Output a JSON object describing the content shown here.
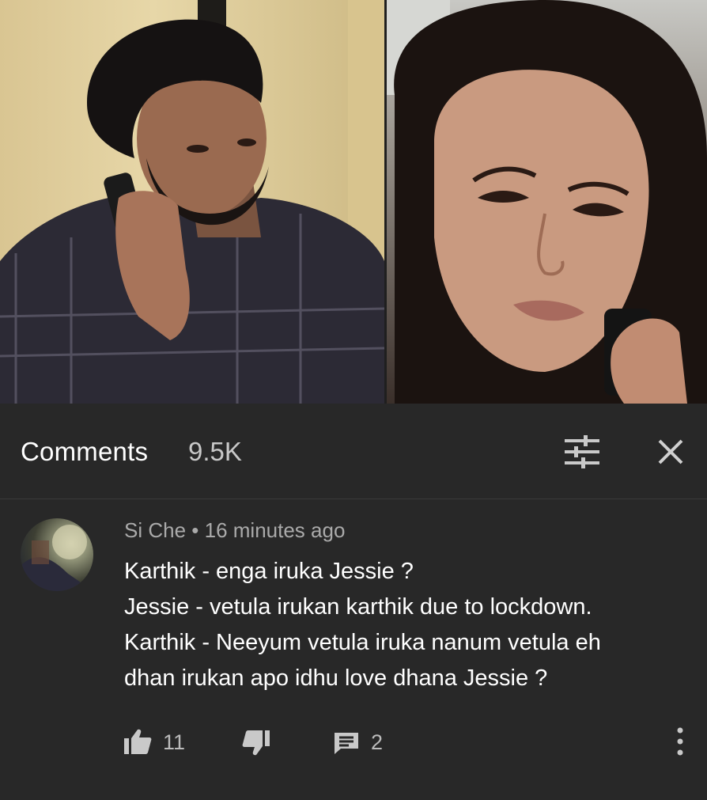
{
  "comments_panel": {
    "title": "Comments",
    "count": "9.5K",
    "sort_icon": "sort-sliders-icon",
    "close_icon": "close-icon"
  },
  "comment": {
    "author": "Si Che",
    "separator": "•",
    "time": "16 minutes ago",
    "lines": [
      "Karthik - enga iruka Jessie ?",
      "Jessie - vetula irukan karthik due to lockdown.",
      "Karthik - Neeyum vetula iruka nanum vetula eh",
      "dhan irukan apo idhu love dhana Jessie ?"
    ],
    "likes": "11",
    "replies": "2",
    "icons": {
      "like": "thumbs-up-icon",
      "dislike": "thumbs-down-icon",
      "reply": "reply-comment-icon",
      "more": "more-vertical-icon"
    }
  },
  "colors": {
    "background": "#282828",
    "text": "#ffffff",
    "secondary_text": "#aaaaaa"
  }
}
